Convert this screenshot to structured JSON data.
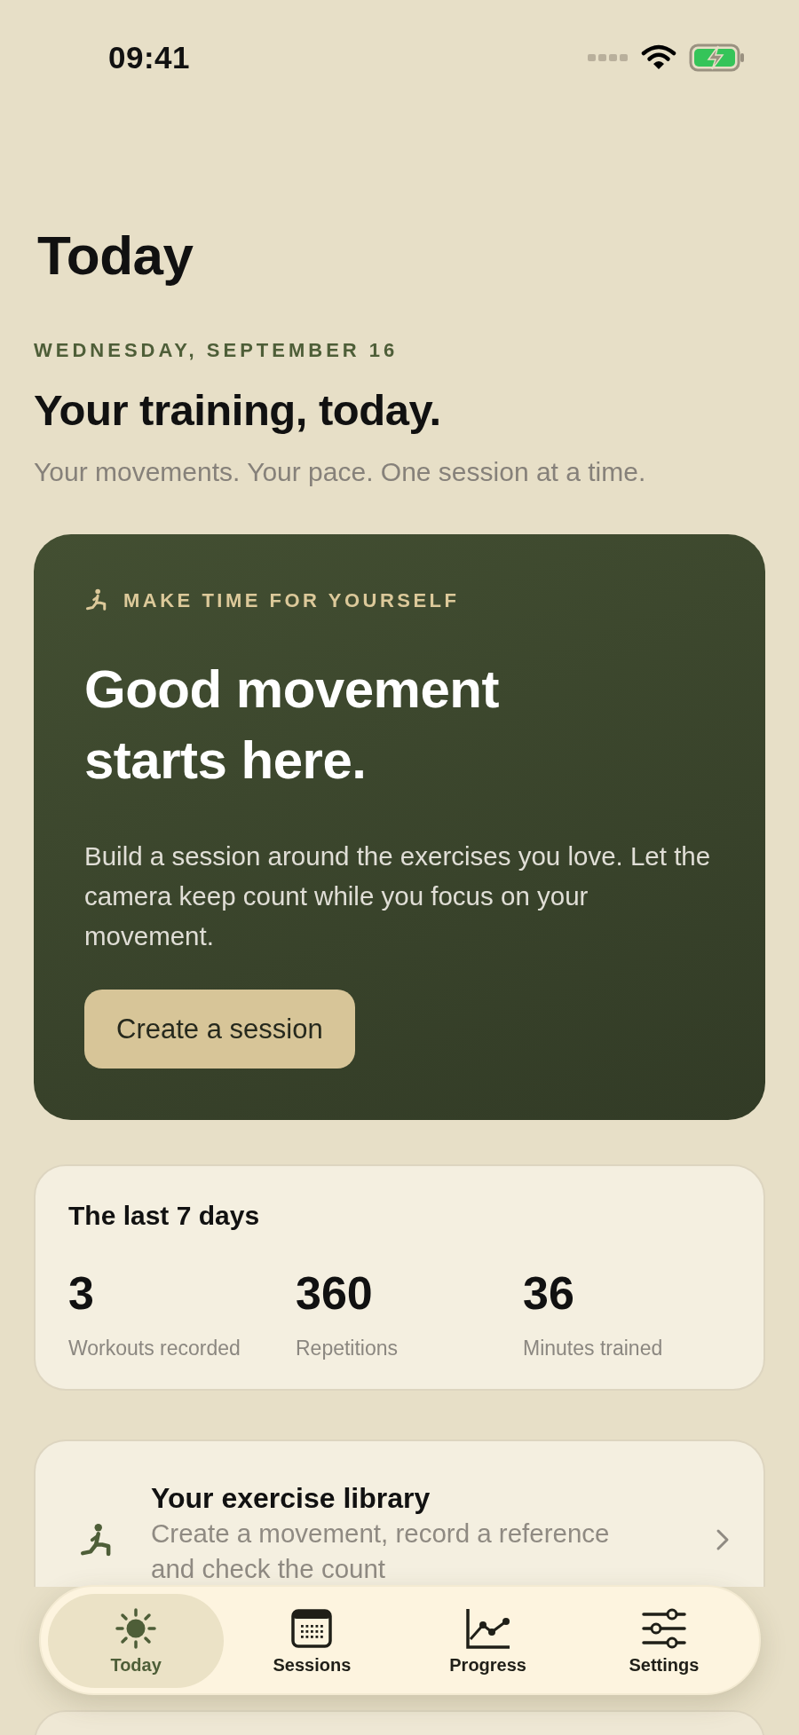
{
  "status_bar": {
    "time": "09:41"
  },
  "header": {
    "title": "Today",
    "date": "WEDNESDAY, SEPTEMBER 16",
    "heading": "Your training, today.",
    "subtitle": "Your movements. Your pace. One session at a time."
  },
  "hero": {
    "eyebrow": "MAKE TIME FOR YOURSELF",
    "headline": "Good movement starts here.",
    "body": "Build a session around the exercises you love. Let the camera keep count while you focus on your movement.",
    "button": "Create a session"
  },
  "stats": {
    "title": "The last 7 days",
    "items": [
      {
        "value": "3",
        "label": "Workouts recorded"
      },
      {
        "value": "360",
        "label": "Repetitions"
      },
      {
        "value": "36",
        "label": "Minutes trained"
      }
    ]
  },
  "library": {
    "title": "Your exercise library",
    "description": "Create a movement, record a reference and check the count"
  },
  "tabs": [
    {
      "label": "Today",
      "selected": true
    },
    {
      "label": "Sessions",
      "selected": false
    },
    {
      "label": "Progress",
      "selected": false
    },
    {
      "label": "Settings",
      "selected": false
    }
  ]
}
